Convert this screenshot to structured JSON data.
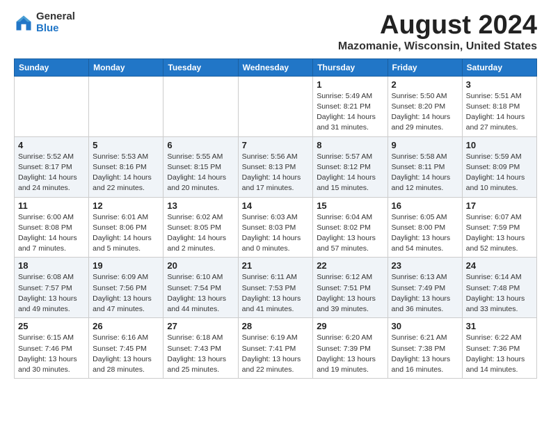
{
  "header": {
    "logo_general": "General",
    "logo_blue": "Blue",
    "month": "August 2024",
    "location": "Mazomanie, Wisconsin, United States"
  },
  "days_of_week": [
    "Sunday",
    "Monday",
    "Tuesday",
    "Wednesday",
    "Thursday",
    "Friday",
    "Saturday"
  ],
  "weeks": [
    [
      {
        "day": "",
        "info": ""
      },
      {
        "day": "",
        "info": ""
      },
      {
        "day": "",
        "info": ""
      },
      {
        "day": "",
        "info": ""
      },
      {
        "day": "1",
        "info": "Sunrise: 5:49 AM\nSunset: 8:21 PM\nDaylight: 14 hours\nand 31 minutes."
      },
      {
        "day": "2",
        "info": "Sunrise: 5:50 AM\nSunset: 8:20 PM\nDaylight: 14 hours\nand 29 minutes."
      },
      {
        "day": "3",
        "info": "Sunrise: 5:51 AM\nSunset: 8:18 PM\nDaylight: 14 hours\nand 27 minutes."
      }
    ],
    [
      {
        "day": "4",
        "info": "Sunrise: 5:52 AM\nSunset: 8:17 PM\nDaylight: 14 hours\nand 24 minutes."
      },
      {
        "day": "5",
        "info": "Sunrise: 5:53 AM\nSunset: 8:16 PM\nDaylight: 14 hours\nand 22 minutes."
      },
      {
        "day": "6",
        "info": "Sunrise: 5:55 AM\nSunset: 8:15 PM\nDaylight: 14 hours\nand 20 minutes."
      },
      {
        "day": "7",
        "info": "Sunrise: 5:56 AM\nSunset: 8:13 PM\nDaylight: 14 hours\nand 17 minutes."
      },
      {
        "day": "8",
        "info": "Sunrise: 5:57 AM\nSunset: 8:12 PM\nDaylight: 14 hours\nand 15 minutes."
      },
      {
        "day": "9",
        "info": "Sunrise: 5:58 AM\nSunset: 8:11 PM\nDaylight: 14 hours\nand 12 minutes."
      },
      {
        "day": "10",
        "info": "Sunrise: 5:59 AM\nSunset: 8:09 PM\nDaylight: 14 hours\nand 10 minutes."
      }
    ],
    [
      {
        "day": "11",
        "info": "Sunrise: 6:00 AM\nSunset: 8:08 PM\nDaylight: 14 hours\nand 7 minutes."
      },
      {
        "day": "12",
        "info": "Sunrise: 6:01 AM\nSunset: 8:06 PM\nDaylight: 14 hours\nand 5 minutes."
      },
      {
        "day": "13",
        "info": "Sunrise: 6:02 AM\nSunset: 8:05 PM\nDaylight: 14 hours\nand 2 minutes."
      },
      {
        "day": "14",
        "info": "Sunrise: 6:03 AM\nSunset: 8:03 PM\nDaylight: 14 hours\nand 0 minutes."
      },
      {
        "day": "15",
        "info": "Sunrise: 6:04 AM\nSunset: 8:02 PM\nDaylight: 13 hours\nand 57 minutes."
      },
      {
        "day": "16",
        "info": "Sunrise: 6:05 AM\nSunset: 8:00 PM\nDaylight: 13 hours\nand 54 minutes."
      },
      {
        "day": "17",
        "info": "Sunrise: 6:07 AM\nSunset: 7:59 PM\nDaylight: 13 hours\nand 52 minutes."
      }
    ],
    [
      {
        "day": "18",
        "info": "Sunrise: 6:08 AM\nSunset: 7:57 PM\nDaylight: 13 hours\nand 49 minutes."
      },
      {
        "day": "19",
        "info": "Sunrise: 6:09 AM\nSunset: 7:56 PM\nDaylight: 13 hours\nand 47 minutes."
      },
      {
        "day": "20",
        "info": "Sunrise: 6:10 AM\nSunset: 7:54 PM\nDaylight: 13 hours\nand 44 minutes."
      },
      {
        "day": "21",
        "info": "Sunrise: 6:11 AM\nSunset: 7:53 PM\nDaylight: 13 hours\nand 41 minutes."
      },
      {
        "day": "22",
        "info": "Sunrise: 6:12 AM\nSunset: 7:51 PM\nDaylight: 13 hours\nand 39 minutes."
      },
      {
        "day": "23",
        "info": "Sunrise: 6:13 AM\nSunset: 7:49 PM\nDaylight: 13 hours\nand 36 minutes."
      },
      {
        "day": "24",
        "info": "Sunrise: 6:14 AM\nSunset: 7:48 PM\nDaylight: 13 hours\nand 33 minutes."
      }
    ],
    [
      {
        "day": "25",
        "info": "Sunrise: 6:15 AM\nSunset: 7:46 PM\nDaylight: 13 hours\nand 30 minutes."
      },
      {
        "day": "26",
        "info": "Sunrise: 6:16 AM\nSunset: 7:45 PM\nDaylight: 13 hours\nand 28 minutes."
      },
      {
        "day": "27",
        "info": "Sunrise: 6:18 AM\nSunset: 7:43 PM\nDaylight: 13 hours\nand 25 minutes."
      },
      {
        "day": "28",
        "info": "Sunrise: 6:19 AM\nSunset: 7:41 PM\nDaylight: 13 hours\nand 22 minutes."
      },
      {
        "day": "29",
        "info": "Sunrise: 6:20 AM\nSunset: 7:39 PM\nDaylight: 13 hours\nand 19 minutes."
      },
      {
        "day": "30",
        "info": "Sunrise: 6:21 AM\nSunset: 7:38 PM\nDaylight: 13 hours\nand 16 minutes."
      },
      {
        "day": "31",
        "info": "Sunrise: 6:22 AM\nSunset: 7:36 PM\nDaylight: 13 hours\nand 14 minutes."
      }
    ]
  ]
}
